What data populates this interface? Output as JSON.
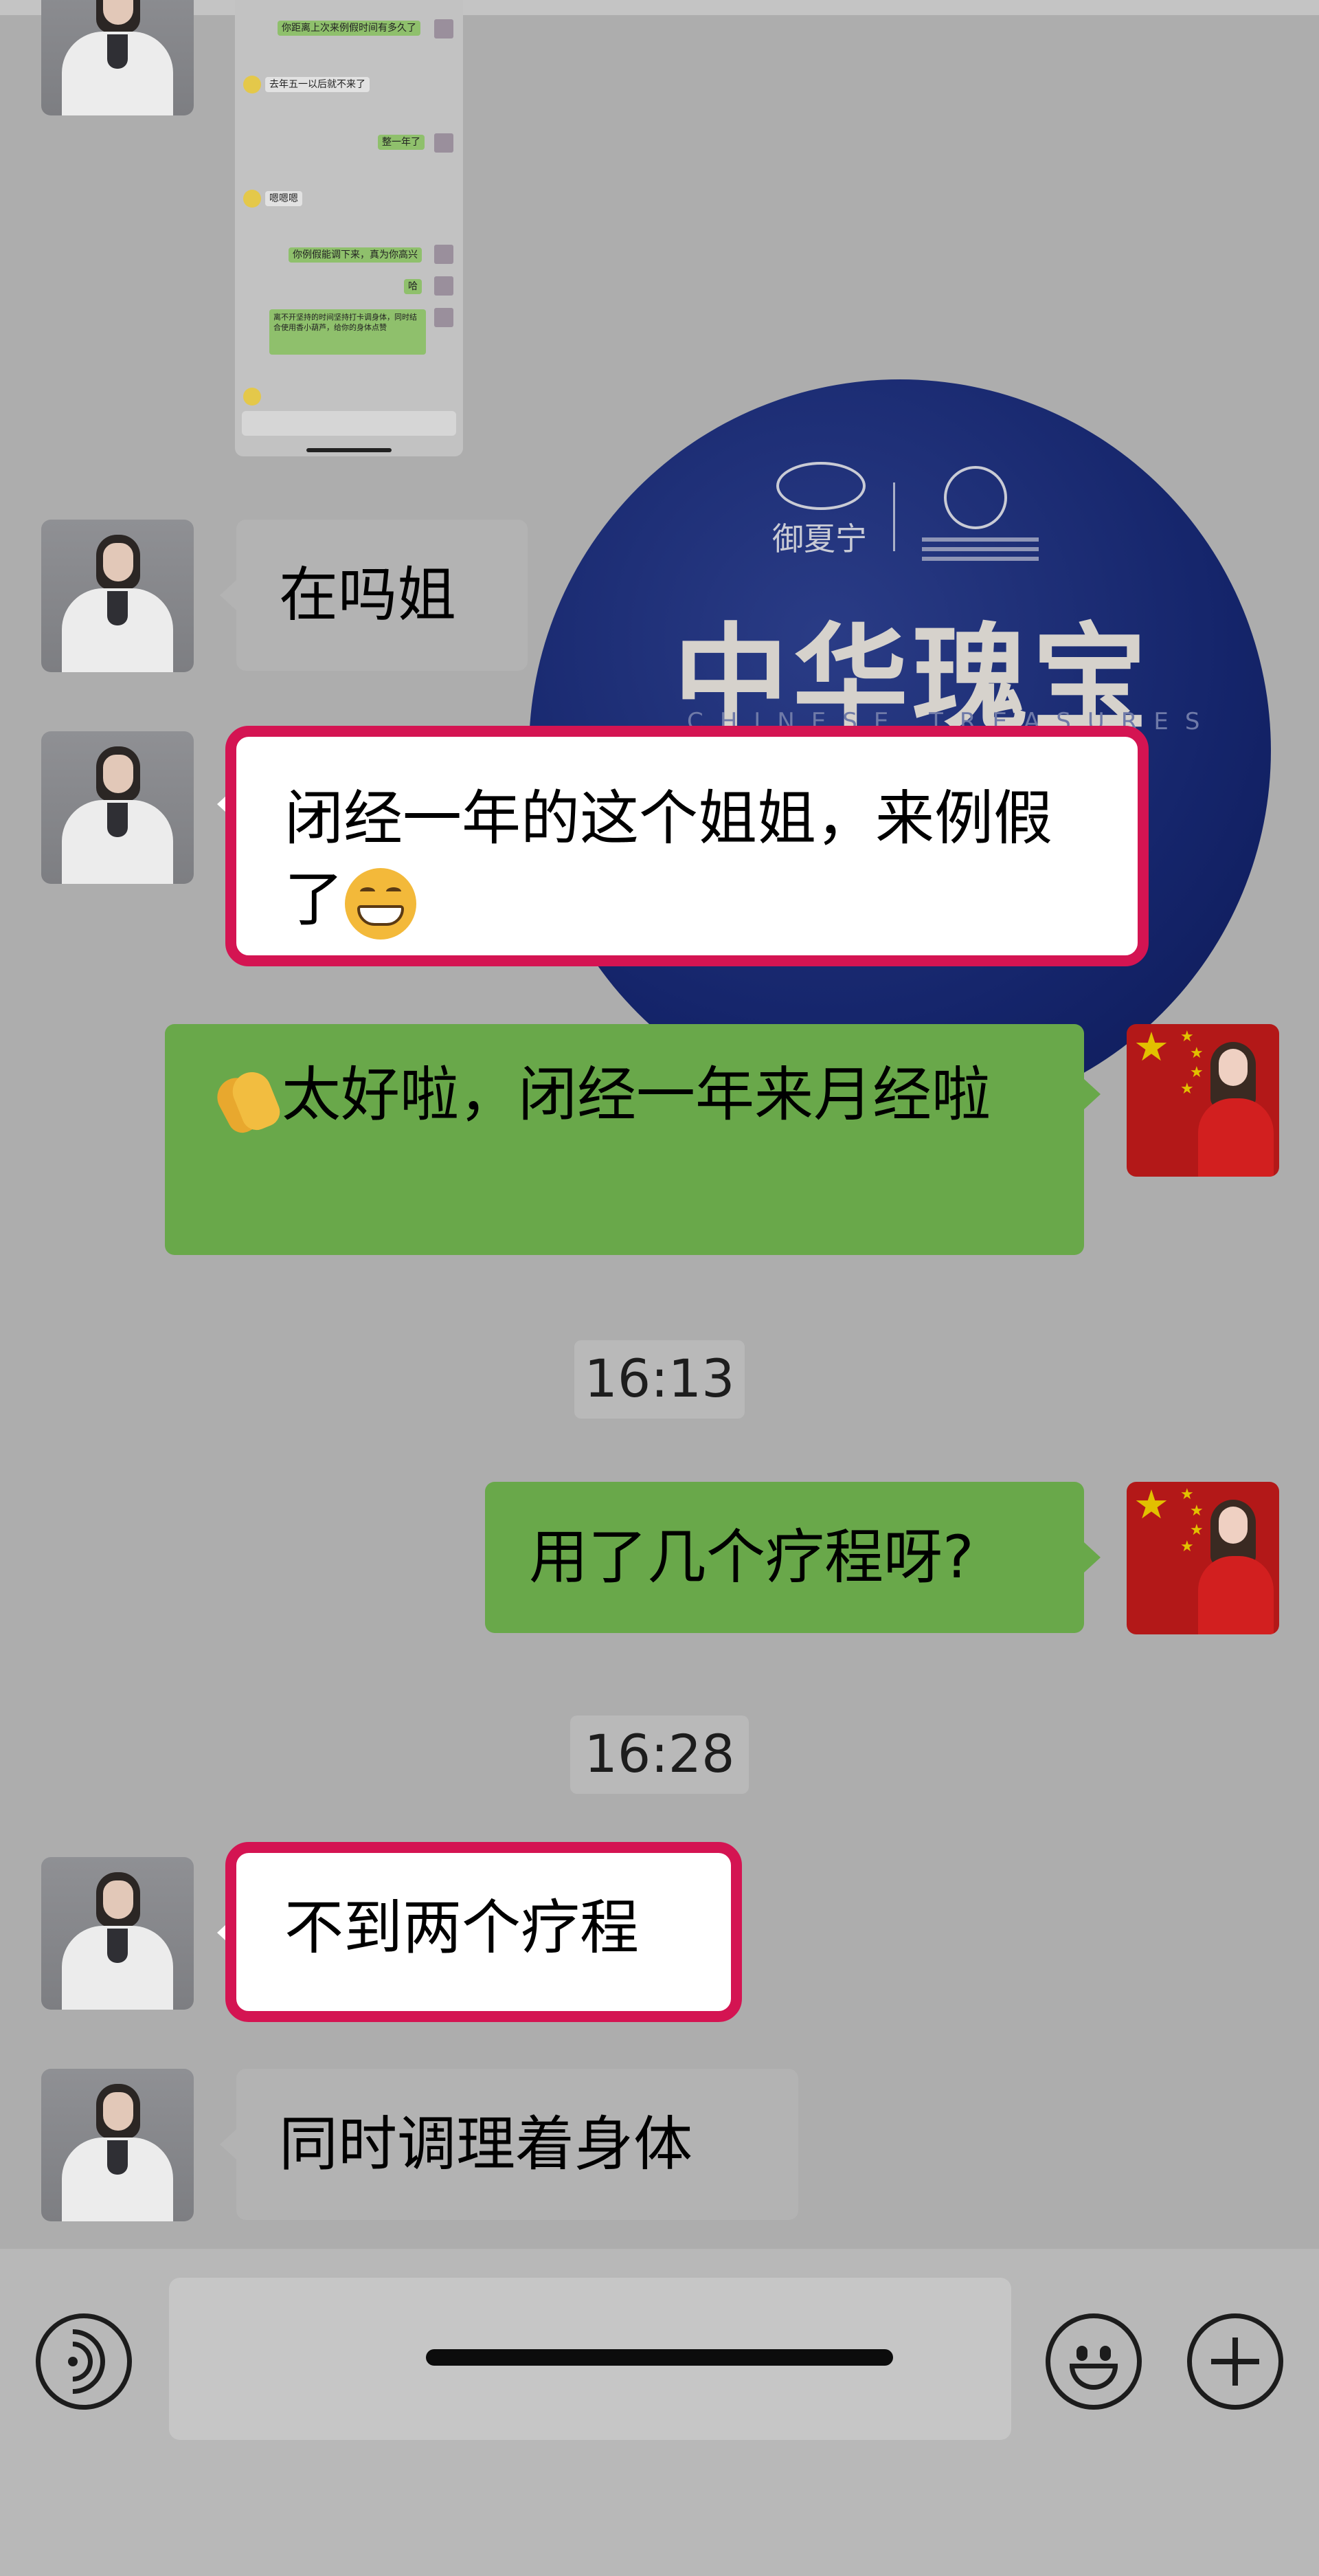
{
  "messages": {
    "m1": "在吗姐",
    "m2": "闭经一年的这个姐姐，来例假了",
    "m3": "太好啦，闭经一年来月经啦",
    "m4": "用了几个疗程呀?",
    "m5": "不到两个疗程",
    "m6": "同时调理着身体"
  },
  "timestamps": {
    "t1": "16:13",
    "t2": "16:28"
  },
  "badge": {
    "title": "中华瑰宝",
    "subtitle_en": "CHINESE TREASURES",
    "brand": "御夏宁"
  },
  "thumbnail": {
    "lines": [
      "你距离上次来例假时间有多久了",
      "去年五一以后就不来了",
      "整一年了",
      "嗯嗯嗯",
      "你例假能调下来，真为你高兴",
      "哈",
      "离不开坚持的时间坚持打卡调身体，同时结合使用香小葫芦，给你的身体点赞"
    ]
  },
  "colors": {
    "green_bubble": "#69a84a",
    "highlight": "#d41452",
    "background": "#adadad"
  },
  "icons": [
    "voice-icon",
    "emoji-icon",
    "plus-icon"
  ]
}
